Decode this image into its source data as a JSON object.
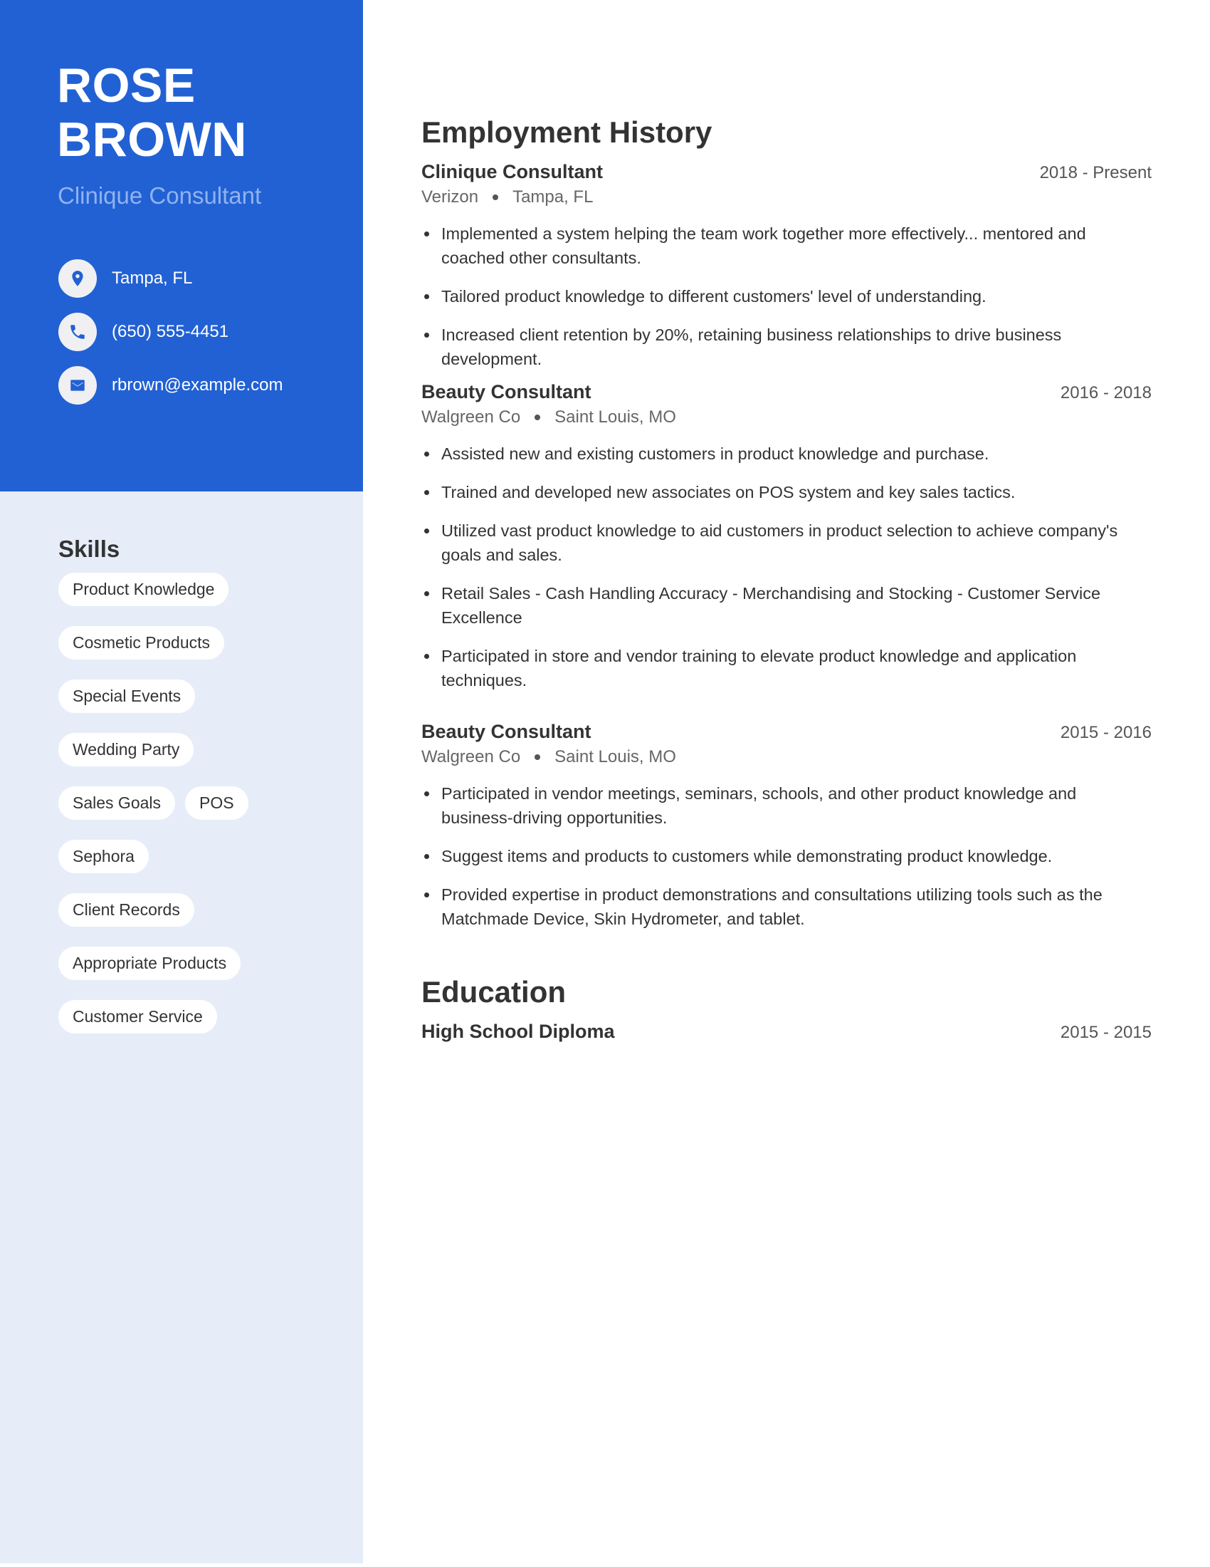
{
  "profile": {
    "first_name": "ROSE",
    "last_name": "BROWN",
    "title": "Clinique Consultant"
  },
  "contact": [
    {
      "icon": "location-pin-icon",
      "text": "Tampa, FL"
    },
    {
      "icon": "phone-icon",
      "text": "(650) 555-4451"
    },
    {
      "icon": "email-icon",
      "text": "rbrown@example.com"
    }
  ],
  "skills": {
    "title": "Skills",
    "items": [
      "Product Knowledge",
      "Cosmetic Products",
      "Special Events",
      "Wedding Party",
      "Sales Goals",
      "POS",
      "Sephora",
      "Client Records",
      "Appropriate Products",
      "Customer Service"
    ]
  },
  "employment": {
    "title": "Employment History",
    "jobs": [
      {
        "role": "Clinique Consultant",
        "dates": "2018 - Present",
        "company": "Verizon",
        "location": "Tampa, FL",
        "bullets": [
          "Implemented a system helping the team work together more effectively... mentored and coached other consultants.",
          "Tailored product knowledge to different customers' level of understanding.",
          "Increased client retention by 20%, retaining business relationships to drive business development."
        ]
      },
      {
        "role": "Beauty Consultant",
        "dates": "2016 - 2018",
        "company": "Walgreen Co",
        "location": "Saint Louis, MO",
        "bullets": [
          "Assisted new and existing customers in product knowledge and purchase.",
          "Trained and developed new associates on POS system and key sales tactics.",
          "Utilized vast product knowledge to aid customers in product selection to achieve company's goals and sales.",
          "Retail Sales - Cash Handling Accuracy - Merchandising and Stocking - Customer Service Excellence",
          "Participated in store and vendor training to elevate product knowledge and application techniques."
        ]
      },
      {
        "role": "Beauty Consultant",
        "dates": "2015 - 2016",
        "company": "Walgreen Co",
        "location": "Saint Louis, MO",
        "bullets": [
          "Participated in vendor meetings, seminars, schools, and other product knowledge and business-driving opportunities.",
          "Suggest items and products to customers while demonstrating product knowledge.",
          "Provided expertise in product demonstrations and consultations utilizing tools such as the Matchmade Device, Skin Hydrometer, and tablet."
        ]
      }
    ]
  },
  "education": {
    "title": "Education",
    "entries": [
      {
        "degree": "High School Diploma",
        "dates": "2015 - 2015"
      }
    ]
  },
  "colors": {
    "accent": "#2261d4",
    "accent_light": "#8fb3f0",
    "sidebar_bg": "#e6edf9",
    "text": "#333333"
  }
}
